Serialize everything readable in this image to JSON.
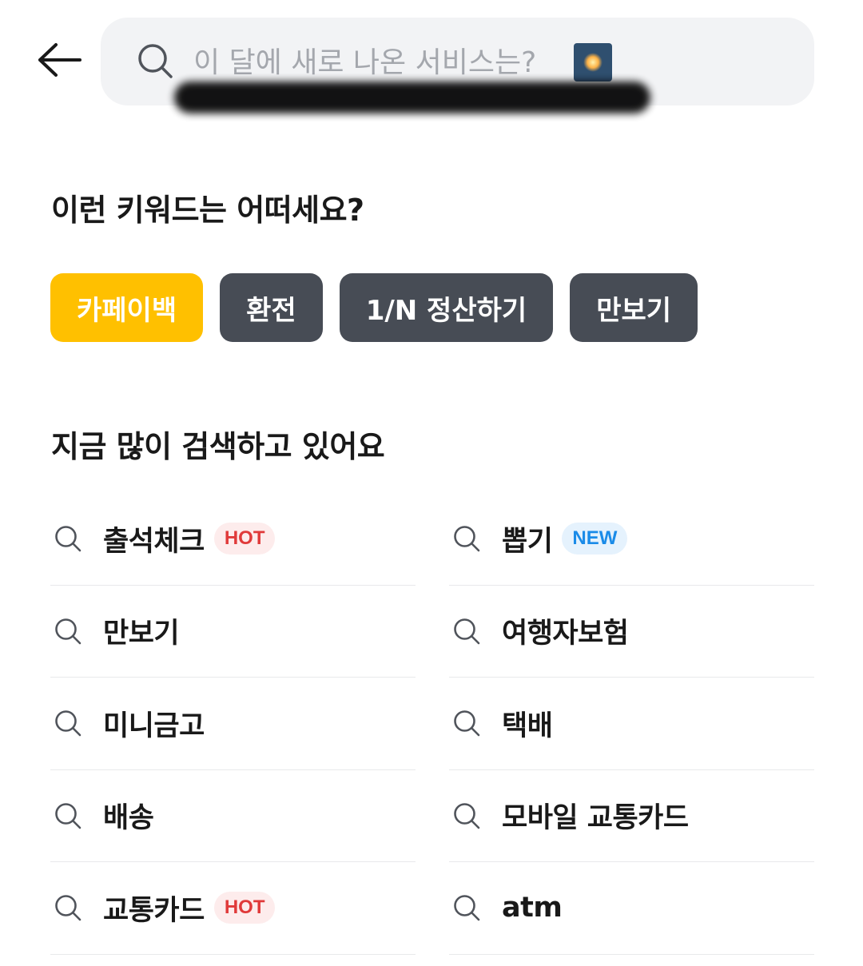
{
  "search": {
    "placeholder": "이 달에 새로 나온 서비스는?"
  },
  "suggested": {
    "title": "이런 키워드는 어떠세요?",
    "chips": [
      {
        "label": "카페이백",
        "active": true
      },
      {
        "label": "환전",
        "active": false
      },
      {
        "label": "1/N 정산하기",
        "active": false
      },
      {
        "label": "만보기",
        "active": false
      }
    ]
  },
  "popular": {
    "title": "지금 많이 검색하고 있어요",
    "items": [
      {
        "label": "출석체크",
        "badge": "HOT"
      },
      {
        "label": "뽑기",
        "badge": "NEW"
      },
      {
        "label": "만보기",
        "badge": ""
      },
      {
        "label": "여행자보험",
        "badge": ""
      },
      {
        "label": "미니금고",
        "badge": ""
      },
      {
        "label": "택배",
        "badge": ""
      },
      {
        "label": "배송",
        "badge": ""
      },
      {
        "label": "모바일 교통카드",
        "badge": ""
      },
      {
        "label": "교통카드",
        "badge": "HOT"
      },
      {
        "label": "atm",
        "badge": ""
      }
    ]
  },
  "colors": {
    "accent_chip": "#ffc000",
    "chip_bg": "#474c55",
    "hot_badge": "#e03a3a",
    "new_badge": "#1a8be8"
  },
  "icons": [
    "back-arrow-icon",
    "search-icon",
    "sparkle-emoji-icon"
  ]
}
